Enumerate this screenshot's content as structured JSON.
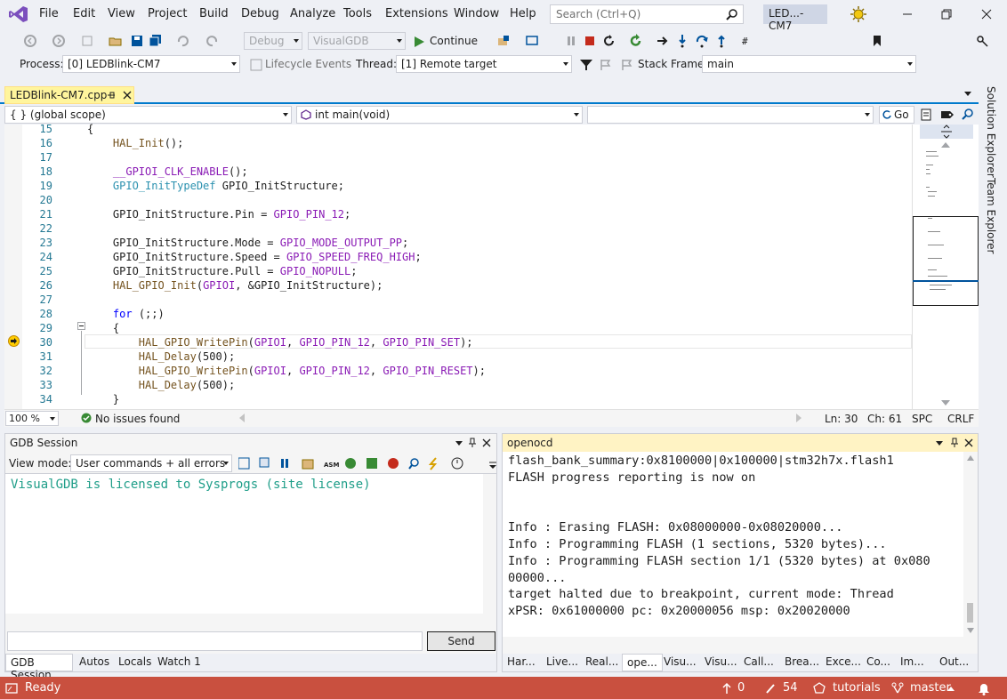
{
  "menu": [
    "File",
    "Edit",
    "View",
    "Project",
    "Build",
    "Debug",
    "Analyze",
    "Tools",
    "Extensions",
    "Window",
    "Help"
  ],
  "search_placeholder": "Search (Ctrl+Q)",
  "solution_badge": "LED...-CM7",
  "toolbar": {
    "config": "Debug",
    "platform": "VisualGDB",
    "continue_label": "Continue"
  },
  "debugbar": {
    "process_label": "Process:",
    "process_value": "[0] LEDBlink-CM7",
    "lifecycle_label": "Lifecycle Events",
    "thread_label": "Thread:",
    "thread_value": "[1] Remote target",
    "stackframe_label": "Stack Frame:",
    "stackframe_value": "main"
  },
  "document_tab": "LEDBlink-CM7.cpp",
  "nav": {
    "scope": "{ } (global scope)",
    "member": "int main(void)",
    "third": "",
    "go_label": "Go"
  },
  "editor": {
    "lines": [
      {
        "n": "15",
        "t": "{"
      },
      {
        "n": "16",
        "t": "    HAL_Init();"
      },
      {
        "n": "17",
        "t": ""
      },
      {
        "n": "18",
        "t": "    __GPIOI_CLK_ENABLE();"
      },
      {
        "n": "19",
        "t": "    GPIO_InitTypeDef GPIO_InitStructure;"
      },
      {
        "n": "20",
        "t": ""
      },
      {
        "n": "21",
        "t": "    GPIO_InitStructure.Pin = GPIO_PIN_12;"
      },
      {
        "n": "22",
        "t": ""
      },
      {
        "n": "23",
        "t": "    GPIO_InitStructure.Mode = GPIO_MODE_OUTPUT_PP;"
      },
      {
        "n": "24",
        "t": "    GPIO_InitStructure.Speed = GPIO_SPEED_FREQ_HIGH;"
      },
      {
        "n": "25",
        "t": "    GPIO_InitStructure.Pull = GPIO_NOPULL;"
      },
      {
        "n": "26",
        "t": "    HAL_GPIO_Init(GPIOI, &GPIO_InitStructure);"
      },
      {
        "n": "27",
        "t": ""
      },
      {
        "n": "28",
        "t": "    for (;;)"
      },
      {
        "n": "29",
        "t": "    {"
      },
      {
        "n": "30",
        "t": "        HAL_GPIO_WritePin(GPIOI, GPIO_PIN_12, GPIO_PIN_SET);"
      },
      {
        "n": "31",
        "t": "        HAL_Delay(500);"
      },
      {
        "n": "32",
        "t": "        HAL_GPIO_WritePin(GPIOI, GPIO_PIN_12, GPIO_PIN_RESET);"
      },
      {
        "n": "33",
        "t": "        HAL_Delay(500);"
      },
      {
        "n": "34",
        "t": "    }"
      }
    ],
    "zoom": "100 %",
    "issues": "No issues found",
    "ln": "Ln: 30",
    "ch": "Ch: 61",
    "spc": "SPC",
    "crlf": "CRLF"
  },
  "gdb": {
    "title": "GDB Session",
    "viewmode_label": "View mode:",
    "viewmode_value": "User commands + all errors",
    "output": "VisualGDB is licensed to Sysprogs (site license)",
    "send_label": "Send",
    "tabs": [
      "GDB Session",
      "Autos",
      "Locals",
      "Watch 1"
    ]
  },
  "openocd": {
    "title": "openocd",
    "lines": [
      "flash_bank_summary:0x8100000|0x100000|stm32h7x.flash1",
      "FLASH progress reporting is now on",
      "",
      "",
      "Info : Erasing FLASH: 0x08000000-0x08020000...",
      "Info : Programming FLASH (1 sections, 5320 bytes)...",
      "Info : Programming FLASH section 1/1 (5320 bytes) at 0x080",
      "00000...",
      "target halted due to breakpoint, current mode: Thread",
      "xPSR: 0x61000000 pc: 0x20000056 msp: 0x20020000"
    ],
    "tabs": [
      "Har...",
      "Live...",
      "Real...",
      "ope...",
      "Visu...",
      "Visu...",
      "Call...",
      "Brea...",
      "Exce...",
      "Co...",
      "Im...",
      "Out..."
    ]
  },
  "side_tabs": [
    "Solution Explorer",
    "Team Explorer"
  ],
  "status": {
    "ready": "Ready",
    "up": "0",
    "pencil": "54",
    "repo": "tutorials",
    "branch": "master"
  },
  "colors": {
    "accent": "#007acc",
    "statusbar": "#c9503f",
    "doctab": "#fff59d",
    "openocd_title": "#fff3c4"
  }
}
